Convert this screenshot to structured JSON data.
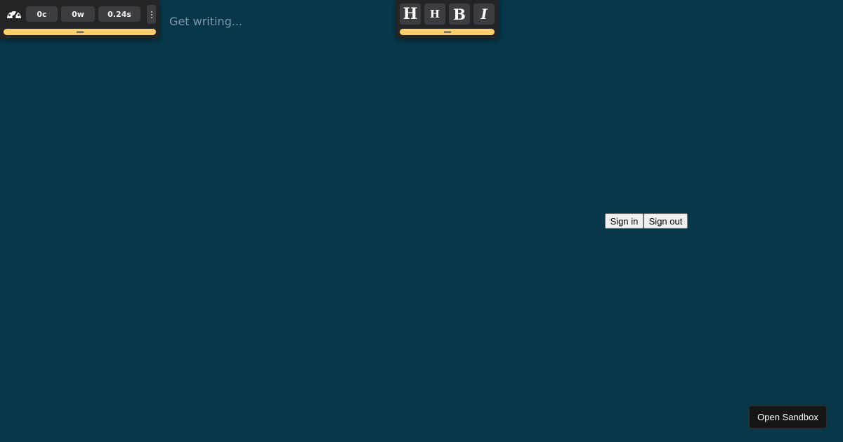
{
  "stats": {
    "characters": "0c",
    "words": "0w",
    "time": "0.24s",
    "icon": "speedometer-icon",
    "menu_icon": "vertical-dots-icon"
  },
  "editor": {
    "placeholder": "Get writing..."
  },
  "format_toolbar": {
    "heading1": "H",
    "heading2": "H",
    "bold": "B",
    "italic": "I"
  },
  "auth": {
    "sign_in": "Sign in",
    "sign_out": "Sign out"
  },
  "sandbox": {
    "label": "Open Sandbox"
  },
  "colors": {
    "background": "#073749",
    "panel": "#222426",
    "button": "#3b3d40",
    "handle": "#fecd6c"
  }
}
